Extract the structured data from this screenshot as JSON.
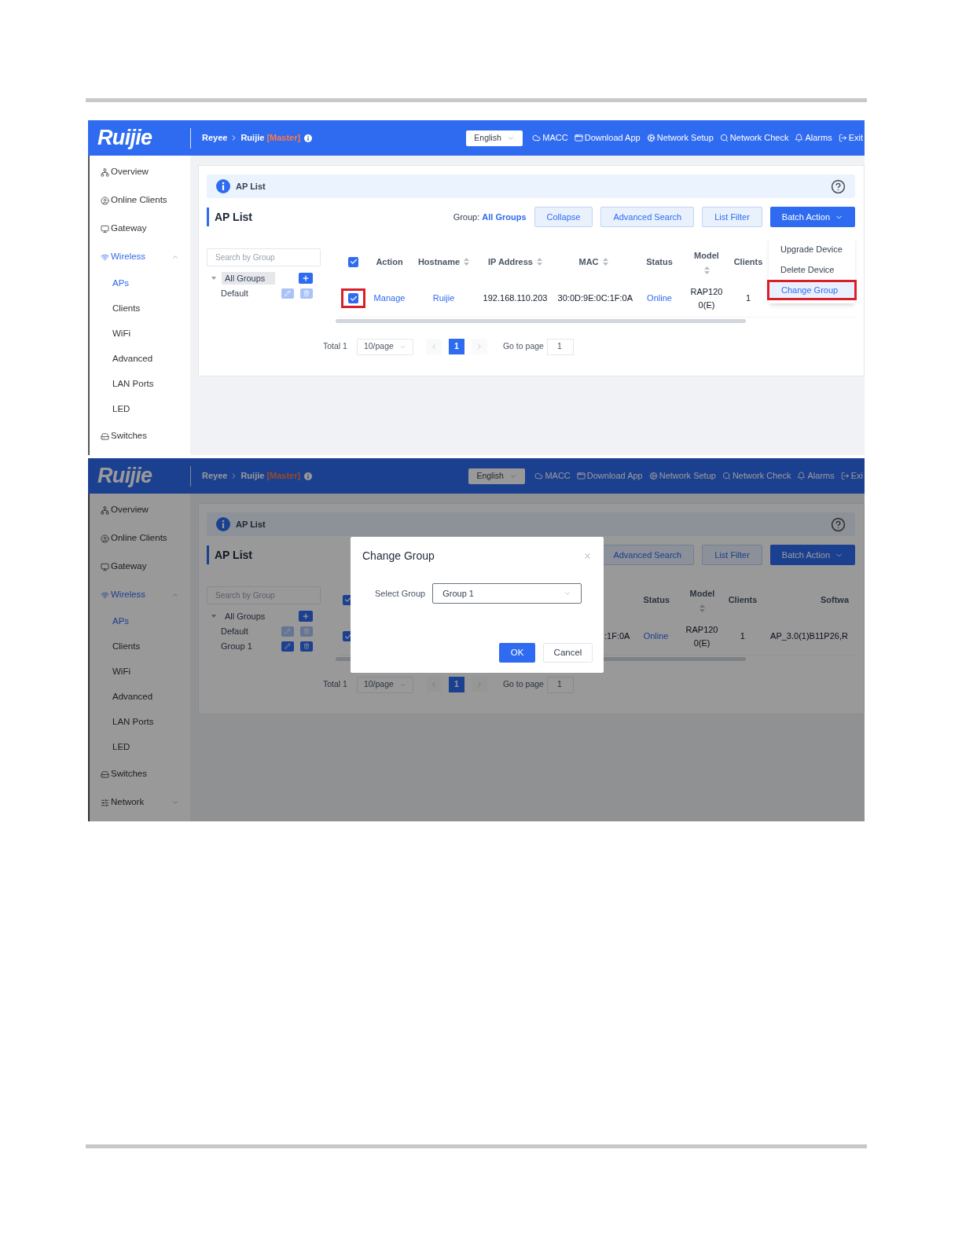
{
  "screens": [
    {
      "header": {
        "logo": "Ruijie",
        "breadcrumb": [
          "Reyee",
          "Ruijie"
        ],
        "role": "[Master]",
        "language": "English",
        "links": [
          "MACC",
          "Download App",
          "Network Setup",
          "Network Check",
          "Alarms",
          "Exit"
        ]
      },
      "sidebar": {
        "items": [
          {
            "label": "Overview",
            "selected": false
          },
          {
            "label": "Online Clients",
            "selected": false
          },
          {
            "label": "Gateway",
            "selected": false
          },
          {
            "label": "Wireless",
            "selected": true,
            "expanded": true,
            "children": [
              {
                "label": "APs",
                "selected": true
              },
              {
                "label": "Clients",
                "selected": false
              },
              {
                "label": "WiFi",
                "selected": false
              },
              {
                "label": "Advanced",
                "selected": false
              },
              {
                "label": "LAN Ports",
                "selected": false
              },
              {
                "label": "LED",
                "selected": false
              }
            ]
          },
          {
            "label": "Switches",
            "selected": false
          }
        ]
      },
      "panel": {
        "banner": "AP List",
        "title": "AP List",
        "group_label": "Group:",
        "group_value": "All Groups",
        "buttons": [
          "Collapse",
          "Advanced Search",
          "List Filter"
        ],
        "batch_action": "Batch Action"
      },
      "menu": {
        "items": [
          {
            "label": "Upgrade Device",
            "selected": false,
            "callout": false
          },
          {
            "label": "Delete Device",
            "selected": false,
            "callout": false
          },
          {
            "label": "Change Group",
            "selected": true,
            "callout": true
          }
        ]
      },
      "groups": {
        "search_placeholder": "Search by Group",
        "root": {
          "label": "All Groups",
          "selected": true,
          "expanded": true,
          "children": [
            {
              "label": "Default",
              "disabled": true
            }
          ]
        }
      },
      "table": {
        "select_all_checked": true,
        "columns": [
          {
            "kind": "action",
            "label": "Action",
            "sortable": false
          },
          {
            "kind": "hostname",
            "label": "Hostname",
            "sortable": true
          },
          {
            "kind": "ip",
            "label": "IP Address",
            "sortable": true
          },
          {
            "kind": "mac",
            "label": "MAC",
            "sortable": true
          },
          {
            "kind": "status",
            "label": "Status",
            "sortable": false
          },
          {
            "kind": "model",
            "label": "Model",
            "sortable": true
          },
          {
            "kind": "clients",
            "label": "Clients",
            "sortable": false
          }
        ],
        "rows": [
          {
            "checked": true,
            "callout": true,
            "cells": [
              "Manage",
              "Ruijie",
              "192.168.110.203",
              "30:0D:9E:0C:1F:0A",
              "Online",
              "RAP1200(E)",
              "1"
            ]
          }
        ]
      },
      "pagination": {
        "total": "Total 1",
        "page_size": "10/page",
        "pages": [
          {
            "label": "1",
            "selected": true
          }
        ],
        "goto_label": "Go to page",
        "goto_value": "1"
      }
    },
    {
      "header": {
        "logo": "Ruijie",
        "breadcrumb": [
          "Reyee",
          "Ruijie"
        ],
        "role": "[Master]",
        "language": "English",
        "links": [
          "MACC",
          "Download App",
          "Network Setup",
          "Network Check",
          "Alarms",
          "Exi"
        ]
      },
      "sidebar": {
        "items": [
          {
            "label": "Overview",
            "selected": false
          },
          {
            "label": "Online Clients",
            "selected": false
          },
          {
            "label": "Gateway",
            "selected": false
          },
          {
            "label": "Wireless",
            "selected": true,
            "expanded": true,
            "children": [
              {
                "label": "APs",
                "selected": true
              },
              {
                "label": "Clients",
                "selected": false
              },
              {
                "label": "WiFi",
                "selected": false
              },
              {
                "label": "Advanced",
                "selected": false
              },
              {
                "label": "LAN Ports",
                "selected": false
              },
              {
                "label": "LED",
                "selected": false
              }
            ]
          },
          {
            "label": "Switches",
            "selected": false
          },
          {
            "label": "Network",
            "selected": false,
            "expanded": false
          }
        ]
      },
      "panel": {
        "banner": "AP List",
        "title": "AP List",
        "buttons": [
          "Advanced Search",
          "List Filter"
        ],
        "batch_action": "Batch Action"
      },
      "groups": {
        "search_placeholder": "Search by Group",
        "root": {
          "label": "All Groups",
          "selected": false,
          "expanded": true,
          "children": [
            {
              "label": "Default",
              "disabled": true
            },
            {
              "label": "Group 1",
              "disabled": false
            }
          ]
        }
      },
      "table": {
        "select_all_checked": true,
        "columns": [
          {
            "kind": "mac"
          },
          {
            "kind": "status",
            "label": "Status",
            "sortable": false
          },
          {
            "kind": "model",
            "label": "Model",
            "sortable": true
          },
          {
            "kind": "clients",
            "label": "Clients",
            "sortable": false
          },
          {
            "kind": "software",
            "label": "Softwa",
            "sortable": false
          }
        ],
        "rows": [
          {
            "checked": true,
            "callout": false,
            "cells": [
              ":1F:0A",
              "Online",
              "RAP1200(E)",
              "1",
              "AP_3.0(1)B11P26,R"
            ]
          }
        ]
      },
      "pagination": {
        "total": "Total 1",
        "page_size": "10/page",
        "pages": [
          {
            "label": "1",
            "selected": true
          }
        ],
        "goto_label": "Go to page",
        "goto_value": "1"
      },
      "dialog": {
        "title": "Change Group",
        "field_label": "Select Group",
        "value": "Group 1",
        "ok": "OK",
        "cancel": "Cancel"
      }
    }
  ]
}
